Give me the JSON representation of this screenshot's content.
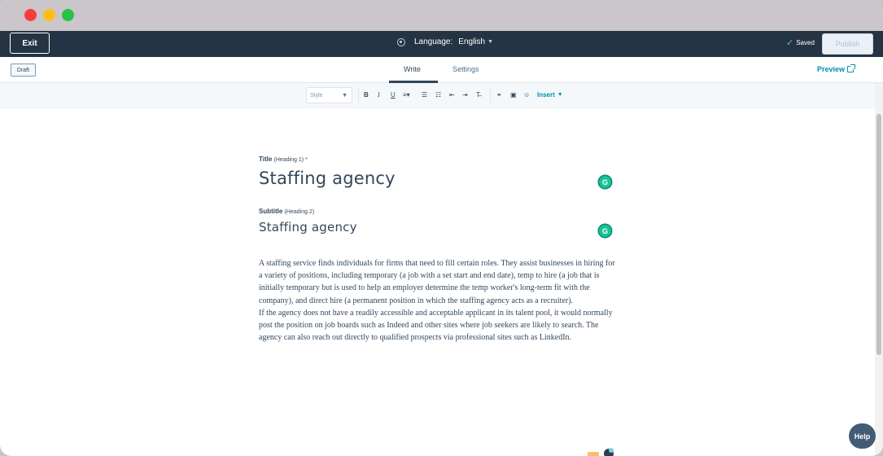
{
  "topbar": {
    "exit_label": "Exit",
    "language_label": "Language:",
    "language_value": "English",
    "saved_label": "Saved",
    "publish_label": "Publish"
  },
  "tabbar": {
    "draft_label": "Draft",
    "tabs": [
      {
        "label": "Write",
        "active": true
      },
      {
        "label": "Settings",
        "active": false
      }
    ],
    "preview_label": "Preview"
  },
  "toolbar": {
    "style_placeholder": "Style",
    "bold": "B",
    "italic": "I",
    "underline": "U",
    "insert_label": "Insert"
  },
  "editor": {
    "title_label": "Title",
    "title_hint": "(Heading 1) *",
    "title_value": "Staffing agency",
    "subtitle_label": "Subtitle",
    "subtitle_hint": "(Heading 2)",
    "subtitle_value": "Staffing agency",
    "grammarly_glyph": "G",
    "body_paragraphs": [
      "A staffing service finds individuals for firms that need to fill certain roles. They assist businesses in hiring for a variety of positions, including temporary (a job with a set start and end date), temp to hire (a job that is initially temporary but is used to help an employer determine the temp worker's long-term fit with the company), and direct hire (a permanent position in which the staffing agency acts as a recruiter).",
      "If the agency does not have a readily accessible and acceptable applicant in its talent pool, it would normally post the position on job boards such as Indeed and other sites where job seekers are likely to search. The agency can also reach out directly to qualified prospects via professional sites such as LinkedIn."
    ]
  },
  "help_label": "Help",
  "colors": {
    "topbar_bg": "#243444",
    "accent": "#0091ae",
    "text": "#33475b",
    "grammarly": "#15c39a"
  }
}
